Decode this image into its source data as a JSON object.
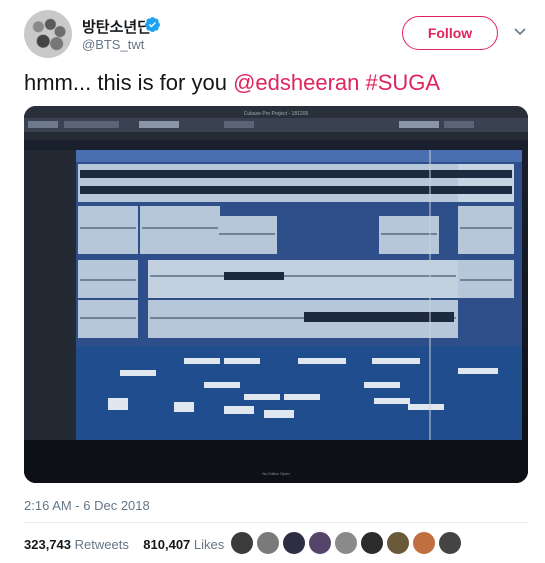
{
  "user": {
    "display_name": "방탄소년단",
    "handle": "@BTS_twt",
    "verified": true,
    "avatar_icon": "group-photo-avatar"
  },
  "follow_button": {
    "label": "Follow",
    "color": "#e0245e"
  },
  "menu": {
    "icon": "chevron-down-icon"
  },
  "tweet": {
    "text_prefix": "hmm... this is for you ",
    "mention": "@edsheeran",
    "hashtag": "#SUGA"
  },
  "media": {
    "description_icon": "daw-screen-photo",
    "window_title": "Cubase Pro Project - 181206",
    "footer_text": "No Editor Open"
  },
  "timestamp": "2:16 AM - 6 Dec 2018",
  "stats": {
    "retweets_count": "323,743",
    "retweets_label": "Retweets",
    "likes_count": "810,407",
    "likes_label": "Likes"
  },
  "liker_colors": [
    "#3b3b3b",
    "#7a7a7a",
    "#2d2d44",
    "#55456b",
    "#8a8a8a",
    "#2b2b2b",
    "#6b5a3a",
    "#c07040",
    "#444"
  ],
  "colors": {
    "accent": "#e0245e",
    "muted": "#657786",
    "text": "#14171a"
  }
}
